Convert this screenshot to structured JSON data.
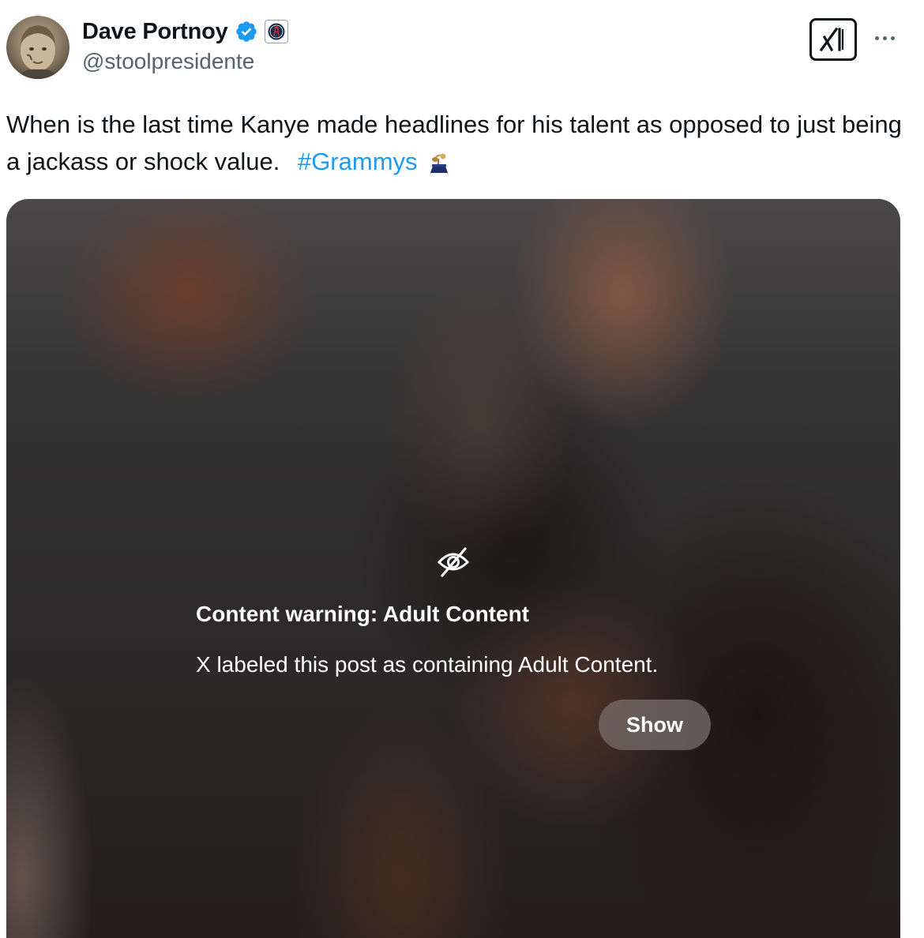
{
  "author": {
    "display_name": "Dave Portnoy",
    "handle": "@stoolpresidente",
    "verified": true
  },
  "tweet": {
    "text": "When is the last time Kanye made headlines for his talent as opposed to just being a jackass or shock value.",
    "hashtag": "#Grammys",
    "emoji_icon": "grammy-trophy-icon"
  },
  "media_warning": {
    "icon": "eye-slash-icon",
    "title": "Content warning: Adult Content",
    "description": "X labeled this post as containing Adult Content.",
    "show_label": "Show"
  },
  "icons": {
    "verified": "verified-badge-icon",
    "affiliate": "barstool-affiliate-badge",
    "grok": "grok-icon",
    "more": "more-options-icon"
  },
  "colors": {
    "link": "#1d9bf0",
    "verified": "#1d9bf0",
    "text_primary": "#0f1419",
    "text_secondary": "#536471"
  }
}
